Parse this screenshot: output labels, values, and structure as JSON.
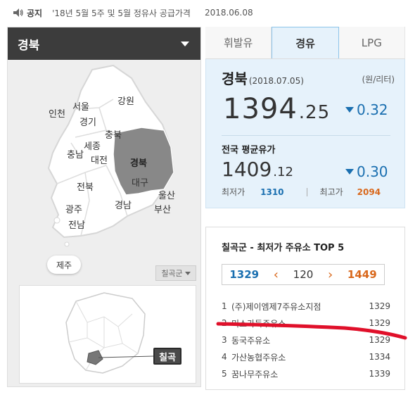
{
  "notice": {
    "tag": "공지",
    "text": "'18년 5월 5주 및 5월 정유사 공급가격",
    "date": "2018.06.08"
  },
  "region": {
    "selected": "경북"
  },
  "map": {
    "labels": [
      "인천",
      "서울",
      "경기",
      "강원",
      "충북",
      "세종",
      "충남",
      "대전",
      "경북",
      "대구",
      "전북",
      "울산",
      "부산",
      "광주",
      "경남",
      "전남"
    ],
    "jeju": "제주",
    "district_select": "칠곡군",
    "district_tag": "칠곡",
    "highlight_color": "#888888"
  },
  "tabs": [
    "휘발유",
    "경유",
    "LPG"
  ],
  "active_tab": "경유",
  "region_price": {
    "name": "경북",
    "date": "(2018.07.05)",
    "unit": "(원/리터)",
    "int": "1394",
    "dec": ".25",
    "change": "0.32"
  },
  "national": {
    "title": "전국 평균유가",
    "int": "1409",
    "dec": ".12",
    "change": "0.30",
    "min_label": "최저가",
    "min": "1310",
    "max_label": "최고가",
    "max": "2094"
  },
  "top5": {
    "title": "칠곡군 - 최저가 주유소 TOP 5",
    "range_low": "1329",
    "range_mid": "120",
    "range_high": "1449",
    "stations": [
      {
        "rank": "1",
        "name": "(주)제이엠제7주유소지점",
        "price": "1329"
      },
      {
        "rank": "2",
        "name": "미소가득주유소",
        "price": "1329"
      },
      {
        "rank": "3",
        "name": "동국주유소",
        "price": "1329"
      },
      {
        "rank": "4",
        "name": "가산농협주유소",
        "price": "1334"
      },
      {
        "rank": "5",
        "name": "꿈나무주유소",
        "price": "1339"
      }
    ]
  },
  "colors": {
    "accent_blue": "#1a6fb0",
    "accent_orange": "#d9681c",
    "marker_red": "#e0102a"
  }
}
